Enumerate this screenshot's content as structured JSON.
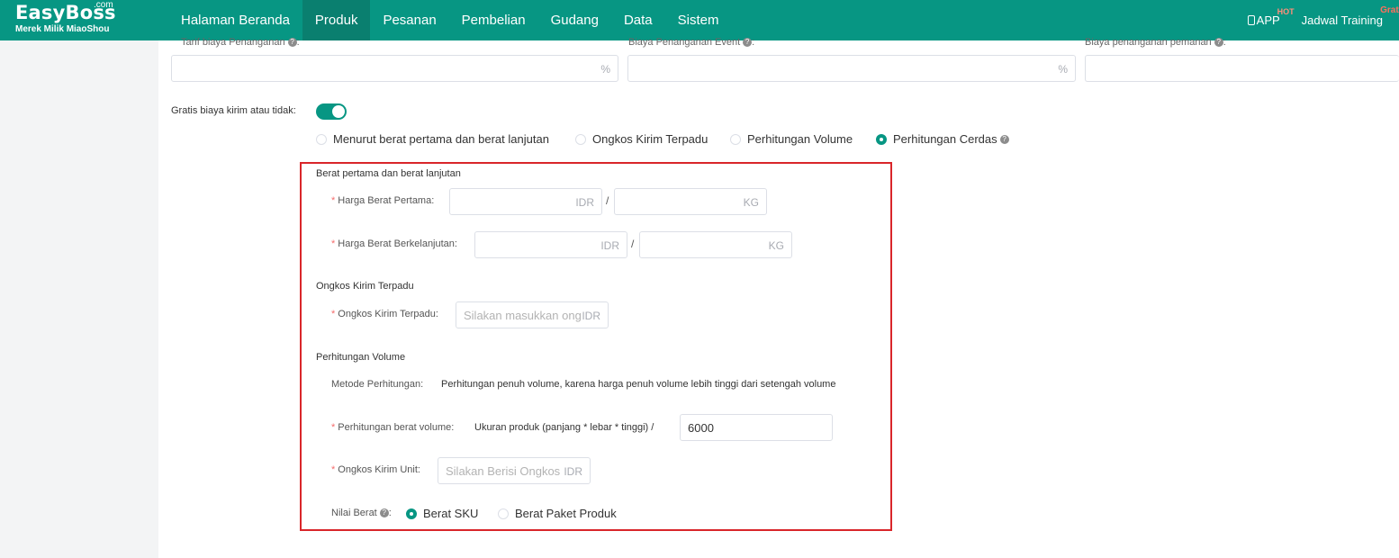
{
  "brand": {
    "name": "EasyBoss",
    "com": ".com",
    "subtitle": "Merek Milik MiaoShou"
  },
  "nav": {
    "items": [
      "Halaman Beranda",
      "Produk",
      "Pesanan",
      "Pembelian",
      "Gudang",
      "Data",
      "Sistem"
    ],
    "active": "Produk",
    "app_label": "APP",
    "app_badge": "HOT",
    "training_label": "Jadwal Training",
    "training_badge": "Gratis"
  },
  "top_fields": [
    {
      "label": "Tarif biaya Penanganan",
      "suffix": "%",
      "help": "?"
    },
    {
      "label": "Biaya Penanganan Event",
      "suffix": "%",
      "help": "?"
    },
    {
      "label": "Biaya penanganan pemanan",
      "suffix": "",
      "help": "?"
    }
  ],
  "free_shipping": {
    "label": "Gratis biaya kirim atau tidak:",
    "enabled": true
  },
  "shipping_methods": {
    "options": [
      "Menurut berat pertama dan berat lanjutan",
      "Ongkos Kirim Terpadu",
      "Perhitungan Volume",
      "Perhitungan Cerdas"
    ],
    "selected": "Perhitungan Cerdas",
    "help": "?"
  },
  "first_weight": {
    "section_title": "Berat pertama dan berat lanjutan",
    "first_price_label": "Harga Berat Pertama:",
    "next_price_label": "Harga Berat Berkelanjutan:",
    "currency": "IDR",
    "unit": "KG",
    "slash": "/"
  },
  "unified": {
    "section_title": "Ongkos Kirim Terpadu",
    "label": "Ongkos Kirim Terpadu:",
    "placeholder": "Silakan masukkan ongkos",
    "currency": "IDR"
  },
  "volume": {
    "section_title": "Perhitungan Volume",
    "method_label": "Metode Perhitungan:",
    "method_value": "Perhitungan penuh volume, karena harga penuh volume lebih tinggi dari setengah volume",
    "weight_label": "Perhitungan berat volume:",
    "weight_formula": "Ukuran produk (panjang * lebar * tinggi) /",
    "divisor": "6000",
    "unit_cost_label": "Ongkos Kirim Unit:",
    "unit_cost_placeholder": "Silakan Berisi Ongkos Kirim",
    "currency": "IDR",
    "weight_value_label": "Nilai Berat",
    "weight_value_help": "?",
    "weight_value_colon": ":",
    "weight_options": [
      "Berat SKU",
      "Berat Paket Produk"
    ],
    "weight_selected": "Berat SKU"
  },
  "required_mark": "*",
  "colors": {
    "primary": "#079683",
    "highlight": "#d9262a",
    "required": "#f56c6c"
  }
}
